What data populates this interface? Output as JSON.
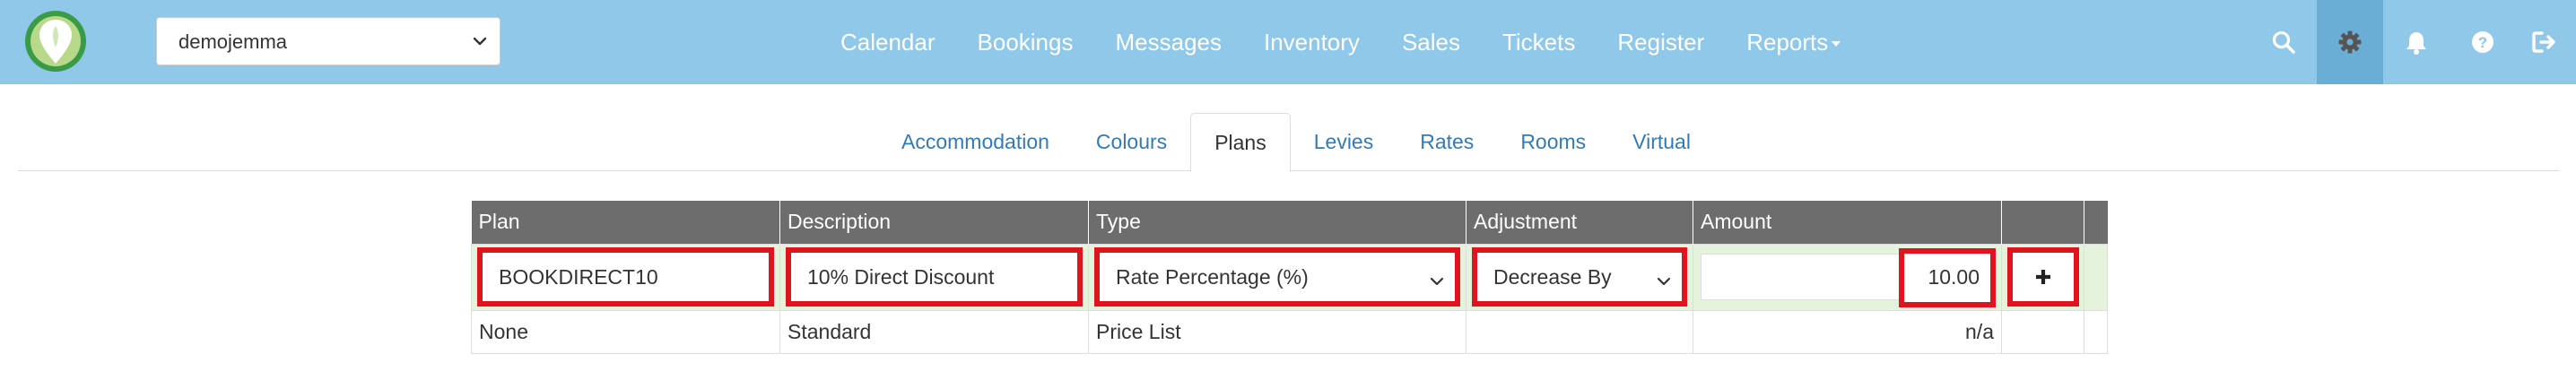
{
  "brand": {
    "logo_icon": "leaf-pin-logo-icon"
  },
  "property_select": {
    "value": "demojemma"
  },
  "nav": {
    "links": [
      "Calendar",
      "Bookings",
      "Messages",
      "Inventory",
      "Sales",
      "Tickets",
      "Register",
      "Reports"
    ],
    "icons": [
      "search-icon",
      "gear-icon",
      "bell-icon",
      "help-icon",
      "logout-icon"
    ]
  },
  "tabs": [
    "Accommodation",
    "Colours",
    "Plans",
    "Levies",
    "Rates",
    "Rooms",
    "Virtual"
  ],
  "active_tab": "Plans",
  "table": {
    "headers": [
      "Plan",
      "Description",
      "Type",
      "Adjustment",
      "Amount",
      "",
      ""
    ],
    "edit_row": {
      "plan": "BOOKDIRECT10",
      "description": "10% Direct Discount",
      "type": "Rate Percentage (%)",
      "adjustment": "Decrease By",
      "amount": "10.00",
      "add_icon": "plus-icon"
    },
    "rows": [
      {
        "plan": "None",
        "description": "Standard",
        "type": "Price List",
        "adjustment": "",
        "amount": "n/a"
      }
    ]
  },
  "colors": {
    "navbar": "#8fc8e8",
    "navbar_active": "#6aaed6",
    "table_header": "#6d6d6d",
    "edit_row": "#e5f2dc",
    "highlight": "#e0141e",
    "link": "#337ab7"
  }
}
